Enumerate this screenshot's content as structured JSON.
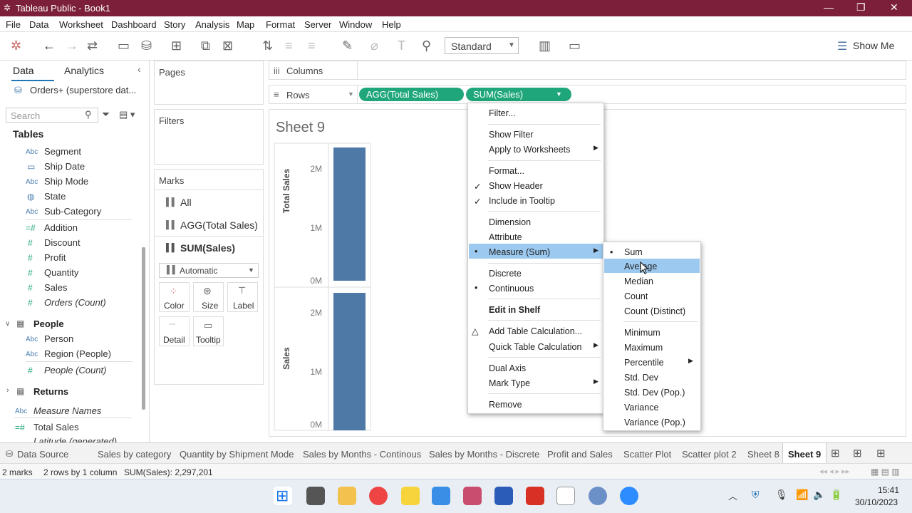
{
  "app": {
    "title": "Tableau Public - Book1"
  },
  "menu": [
    "File",
    "Data",
    "Worksheet",
    "Dashboard",
    "Story",
    "Analysis",
    "Map",
    "Format",
    "Server",
    "Window",
    "Help"
  ],
  "toolbar": {
    "standard": "Standard",
    "show_me": "Show Me"
  },
  "left": {
    "tab_data": "Data",
    "tab_analytics": "Analytics",
    "datasource": "Orders+ (superstore dat...",
    "search_placeholder": "Search",
    "tables_label": "Tables",
    "fields": [
      {
        "type": "Abc",
        "name": "Segment"
      },
      {
        "type": "cal",
        "name": "Ship Date"
      },
      {
        "type": "Abc",
        "name": "Ship Mode"
      },
      {
        "type": "globe",
        "name": "State"
      },
      {
        "type": "Abc",
        "name": "Sub-Category"
      },
      {
        "type": "#",
        "name": "Addition"
      },
      {
        "type": "#",
        "name": "Discount"
      },
      {
        "type": "#",
        "name": "Profit"
      },
      {
        "type": "#",
        "name": "Quantity"
      },
      {
        "type": "#",
        "name": "Sales"
      },
      {
        "type": "#",
        "name": "Orders (Count)"
      }
    ],
    "people": "People",
    "people_fields": [
      {
        "type": "Abc",
        "name": "Person"
      },
      {
        "type": "Abc",
        "name": "Region (People)"
      },
      {
        "type": "#",
        "name": "People (Count)"
      }
    ],
    "returns": "Returns",
    "extra": [
      {
        "type": "Abc",
        "name": "Measure Names"
      },
      {
        "type": "#",
        "name": "Total Sales"
      },
      {
        "type": "#",
        "name": "Latitude (generated)"
      }
    ]
  },
  "cards": {
    "pages": "Pages",
    "filters": "Filters",
    "marks": "Marks",
    "marks_all": "All",
    "marks_agg": "AGG(Total Sales)",
    "marks_sum": "SUM(Sales)",
    "mark_type": "Automatic",
    "color": "Color",
    "size": "Size",
    "label": "Label",
    "detail": "Detail",
    "tooltip": "Tooltip"
  },
  "shelves": {
    "columns": "Columns",
    "rows": "Rows",
    "pill1": "AGG(Total Sales)",
    "pill2": "SUM(Sales)"
  },
  "sheet": {
    "title": "Sheet 9",
    "axis1_label": "Total Sales",
    "axis2_label": "Sales",
    "ticks1": [
      "2M",
      "1M",
      "0M"
    ],
    "ticks2": [
      "2M",
      "1M",
      "0M"
    ]
  },
  "chart_data": [
    {
      "type": "bar",
      "ylabel": "Total Sales",
      "ylim": [
        0,
        2400000
      ],
      "values": [
        2297201
      ]
    },
    {
      "type": "bar",
      "ylabel": "Sales",
      "ylim": [
        0,
        2400000
      ],
      "values": [
        2297201
      ]
    }
  ],
  "context_menu": [
    "Filter...",
    "Show Filter",
    "Apply to Worksheets",
    "Format...",
    "Show Header",
    "Include in Tooltip",
    "Dimension",
    "Attribute",
    "Measure (Sum)",
    "Discrete",
    "Continuous",
    "Edit in Shelf",
    "Add Table Calculation...",
    "Quick Table Calculation",
    "Dual Axis",
    "Mark Type",
    "Remove"
  ],
  "submenu": [
    "Sum",
    "Average",
    "Median",
    "Count",
    "Count (Distinct)",
    "Minimum",
    "Maximum",
    "Percentile",
    "Std. Dev",
    "Std. Dev (Pop.)",
    "Variance",
    "Variance (Pop.)"
  ],
  "tabs": [
    "Data Source",
    "Sales by category",
    "Quantity by Shipment Mode",
    "Sales by Months - Continous",
    "Sales by Months - Discrete",
    "Profit and Sales",
    "Scatter Plot",
    "Scatter plot 2",
    "Sheet 8",
    "Sheet 9"
  ],
  "status": {
    "marks": "2 marks",
    "rows": "2 rows by 1 column",
    "sum": "SUM(Sales): 2,297,201"
  },
  "clock": {
    "time": "15:41",
    "date": "30/10/2023"
  }
}
